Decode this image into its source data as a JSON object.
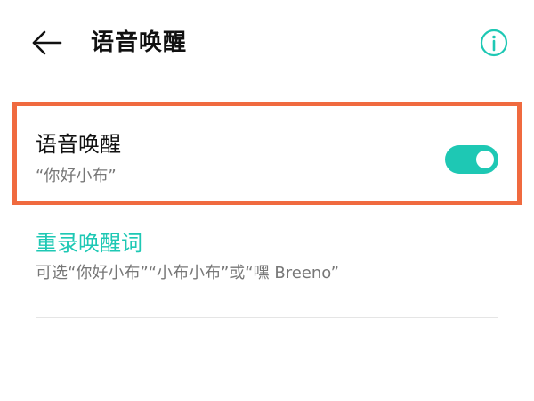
{
  "header": {
    "title": "语音唤醒",
    "back_icon": "arrow-left-icon",
    "info_icon": "info-circle-icon"
  },
  "wake_setting": {
    "title": "语音唤醒",
    "subtitle": "“你好小布”",
    "enabled": true
  },
  "rerecord": {
    "title": "重录唤醒词",
    "subtitle": "可选“你好小布”“小布小布”或“嘿 Breeno”"
  },
  "colors": {
    "accent": "#1ec8b4",
    "highlight_border": "#f06a3f",
    "primary_text": "#111111",
    "secondary_text": "#777777",
    "divider": "#e5e5e5"
  }
}
